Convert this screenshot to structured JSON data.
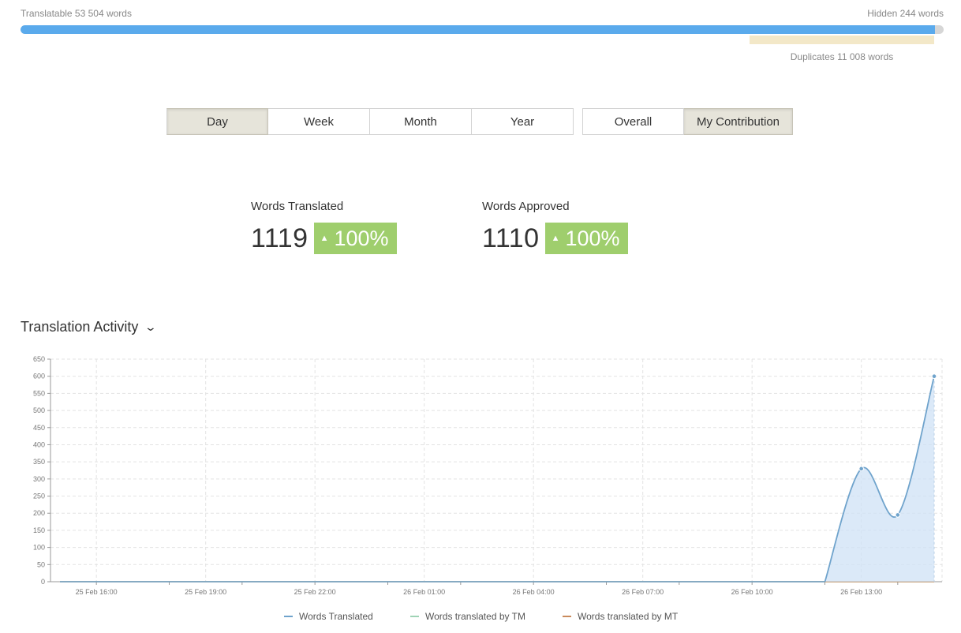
{
  "summary": {
    "translatable_label": "Translatable 53 504 words",
    "hidden_label": "Hidden 244 words",
    "duplicates_label": "Duplicates 11 008 words",
    "translatable_progress": 0.991
  },
  "filters": {
    "period": [
      "Day",
      "Week",
      "Month",
      "Year"
    ],
    "period_selected": "Day",
    "scope": [
      "Overall",
      "My Contribution"
    ],
    "scope_selected": "My Contribution"
  },
  "stats": {
    "translated": {
      "label": "Words Translated",
      "value": "1119",
      "change": "100%"
    },
    "approved": {
      "label": "Words Approved",
      "value": "1110",
      "change": "100%"
    }
  },
  "activity": {
    "title": "Translation Activity"
  },
  "chart_data": {
    "type": "area",
    "x_tick_labels": [
      "25 Feb 16:00",
      "25 Feb 19:00",
      "25 Feb 22:00",
      "26 Feb 01:00",
      "26 Feb 04:00",
      "26 Feb 07:00",
      "26 Feb 10:00",
      "26 Feb 13:00"
    ],
    "ylim": [
      0,
      650
    ],
    "yticks": [
      0,
      50,
      100,
      150,
      200,
      250,
      300,
      350,
      400,
      450,
      500,
      550,
      600,
      650
    ],
    "grid": true,
    "legend_position": "bottom",
    "series": [
      {
        "name": "Words Translated",
        "color": "#6fa3cc",
        "points": [
          {
            "x": "26 Feb 12:00",
            "y": 0
          },
          {
            "x": "26 Feb 13:00",
            "y": 330
          },
          {
            "x": "26 Feb 14:00",
            "y": 195
          },
          {
            "x": "26 Feb 15:00",
            "y": 600
          }
        ]
      },
      {
        "name": "Words translated by TM",
        "color": "#9fd3b5",
        "points": []
      },
      {
        "name": "Words translated by MT",
        "color": "#c98a5c",
        "points": []
      }
    ]
  }
}
